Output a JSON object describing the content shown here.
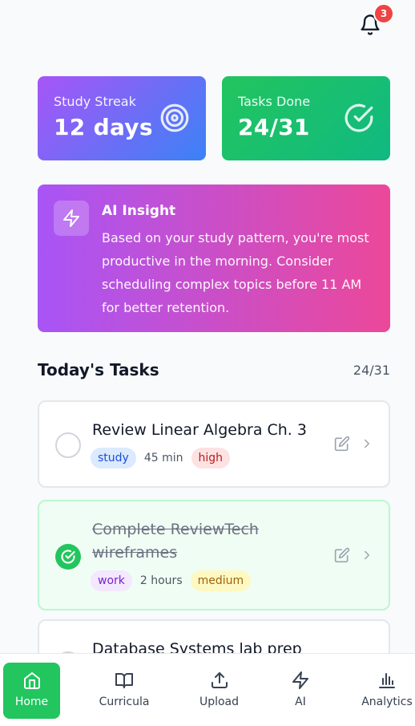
{
  "header": {
    "notification_count": "3"
  },
  "stats": {
    "streak": {
      "label": "Study Streak",
      "value": "12 days",
      "icon": "target-icon"
    },
    "tasks_done": {
      "label": "Tasks Done",
      "value": "24/31",
      "icon": "check-circle-icon"
    }
  },
  "insight": {
    "title": "AI Insight",
    "text": "Based on your study pattern, you're most productive in the morning. Consider scheduling complex topics before 11 AM for better retention.",
    "icon": "lightning-icon"
  },
  "tasks_section": {
    "title": "Today's Tasks",
    "count": "24/31",
    "items": [
      {
        "title": "Review Linear Algebra Ch. 3",
        "category": "study",
        "duration": "45 min",
        "priority": "high",
        "completed": false
      },
      {
        "title": "Complete ReviewTech wireframes",
        "category": "work",
        "duration": "2 hours",
        "priority": "medium",
        "completed": true
      },
      {
        "title": "Database Systems lab prep",
        "completed": false
      }
    ]
  },
  "nav": {
    "items": [
      {
        "label": "Home",
        "icon": "home-icon",
        "active": true
      },
      {
        "label": "Curricula",
        "icon": "book-icon",
        "active": false
      },
      {
        "label": "Upload",
        "icon": "upload-icon",
        "active": false
      },
      {
        "label": "AI",
        "icon": "lightning-icon",
        "active": false
      },
      {
        "label": "Analytics",
        "icon": "bar-chart-icon",
        "active": false
      }
    ]
  },
  "colors": {
    "accent_green": "#22c55e",
    "badge_red": "#ef4444",
    "streak_gradient": [
      "#a855f7",
      "#3b82f6"
    ],
    "insight_gradient": [
      "#a855f7",
      "#ec4899"
    ]
  }
}
